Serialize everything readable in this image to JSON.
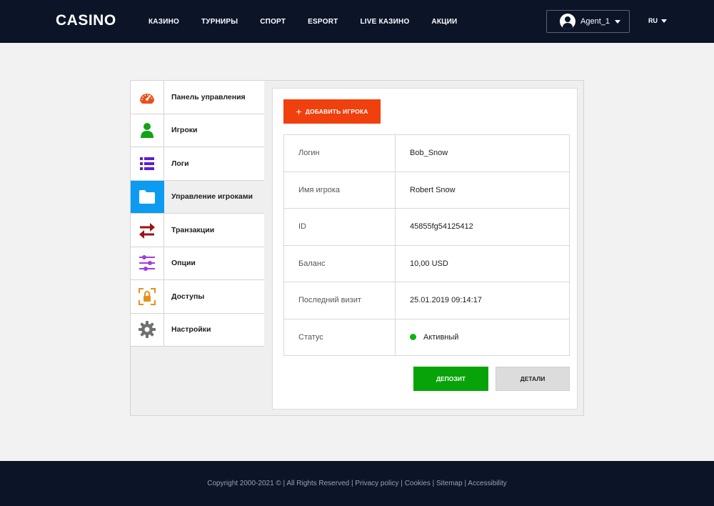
{
  "header": {
    "logo": "CASINO",
    "nav": [
      "КАЗИНО",
      "ТУРНИРЫ",
      "СПОРТ",
      "ESPORT",
      "LIVE КАЗИНО",
      "АКЦИИ"
    ],
    "user": "Agent_1",
    "lang": "RU"
  },
  "sidebar": {
    "items": [
      {
        "label": "Панель управления",
        "icon": "speedometer-icon"
      },
      {
        "label": "Игроки",
        "icon": "user-icon"
      },
      {
        "label": "Логи",
        "icon": "list-icon"
      },
      {
        "label": "Управление игроками",
        "icon": "folder-icon"
      },
      {
        "label": "Транзакции",
        "icon": "transfer-arrows-icon"
      },
      {
        "label": "Опции",
        "icon": "sliders-icon"
      },
      {
        "label": "Доступы",
        "icon": "lock-icon"
      },
      {
        "label": "Настройки",
        "icon": "gear-icon"
      }
    ],
    "active_index": 3
  },
  "content": {
    "add_button": "ДОБАВИТЬ ИГРОКА",
    "rows": [
      {
        "key": "Логин",
        "value": "Bob_Snow"
      },
      {
        "key": "Имя игрока",
        "value": "Robert Snow"
      },
      {
        "key": "ID",
        "value": "45855fg54125412"
      },
      {
        "key": "Баланс",
        "value": "10,00 USD"
      },
      {
        "key": "Последний визит",
        "value": "25.01.2019 09:14:17"
      },
      {
        "key": "Статус",
        "value": "Активный"
      }
    ],
    "deposit_button": "ДЕПОЗИТ",
    "details_button": "ДЕТАЛИ"
  },
  "footer": {
    "copyright": "Copyright 2000-2021 © | All Rights Reserved",
    "links": [
      "Privacy policy",
      "Cookies",
      "Sitemap",
      "Accessibility"
    ]
  },
  "colors": {
    "header_bg": "#0c1528",
    "accent_orange": "#f0400e",
    "active_blue": "#0d9bf2",
    "deposit_green": "#08a308",
    "status_green": "#11b312"
  }
}
